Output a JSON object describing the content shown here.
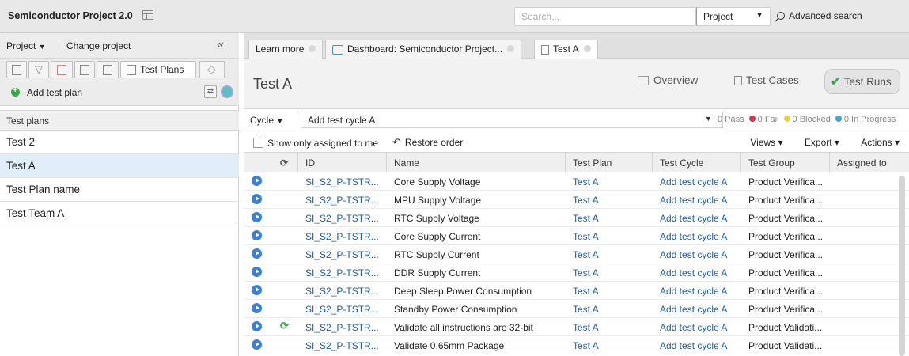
{
  "app": {
    "title": "Semiconductor Project 2.0"
  },
  "topbar": {
    "search_placeholder": "Search...",
    "scope": "Project",
    "advanced_search": "Advanced search"
  },
  "left": {
    "project_menu": "Project",
    "change_project": "Change project",
    "collapse": "«",
    "active_tab": "Test Plans",
    "add_label": "Add test plan",
    "list_header": "Test plans",
    "items": [
      "Test 2",
      "Test A",
      "Test Plan name",
      "Test Team A"
    ],
    "selected_index": 1
  },
  "tabs": [
    {
      "label": "Learn more"
    },
    {
      "label": "Dashboard: Semiconductor Project..."
    },
    {
      "label": "Test A"
    }
  ],
  "header": {
    "title": "Test A",
    "nav": [
      "Overview",
      "Test Cases",
      "Test Runs"
    ],
    "active_nav": "Test Runs"
  },
  "cycle": {
    "label": "Cycle",
    "value": "Add test cycle A",
    "stats": [
      {
        "label": "0 Pass",
        "color": "#3aa84a"
      },
      {
        "label": "0 Fail",
        "color": "#d8384a"
      },
      {
        "label": "0 Blocked",
        "color": "#e8d04a"
      },
      {
        "label": "0 In Progress",
        "color": "#4aa0d8"
      }
    ]
  },
  "filter": {
    "show_assigned": "Show only assigned to me",
    "restore": "Restore order",
    "views": "Views",
    "export": "Export",
    "actions": "Actions"
  },
  "grid": {
    "columns": [
      "ID",
      "Name",
      "Test Plan",
      "Test Cycle",
      "Test Group",
      "Assigned to"
    ],
    "rows": [
      {
        "id": "SI_S2_P-TSTR...",
        "name": "Core Supply Voltage",
        "plan": "Test A",
        "cycle": "Add test cycle A",
        "group": "Product Verifica...",
        "sync": false
      },
      {
        "id": "SI_S2_P-TSTR...",
        "name": "MPU Supply Voltage",
        "plan": "Test A",
        "cycle": "Add test cycle A",
        "group": "Product Verifica...",
        "sync": false
      },
      {
        "id": "SI_S2_P-TSTR...",
        "name": "RTC Supply Voltage",
        "plan": "Test A",
        "cycle": "Add test cycle A",
        "group": "Product Verifica...",
        "sync": false
      },
      {
        "id": "SI_S2_P-TSTR...",
        "name": "Core Supply Current",
        "plan": "Test A",
        "cycle": "Add test cycle A",
        "group": "Product Verifica...",
        "sync": false
      },
      {
        "id": "SI_S2_P-TSTR...",
        "name": "RTC Supply Current",
        "plan": "Test A",
        "cycle": "Add test cycle A",
        "group": "Product Verifica...",
        "sync": false
      },
      {
        "id": "SI_S2_P-TSTR...",
        "name": "DDR Supply Current",
        "plan": "Test A",
        "cycle": "Add test cycle A",
        "group": "Product Verifica...",
        "sync": false
      },
      {
        "id": "SI_S2_P-TSTR...",
        "name": "Deep Sleep Power Consumption",
        "plan": "Test A",
        "cycle": "Add test cycle A",
        "group": "Product Verifica...",
        "sync": false
      },
      {
        "id": "SI_S2_P-TSTR...",
        "name": "Standby Power Consumption",
        "plan": "Test A",
        "cycle": "Add test cycle A",
        "group": "Product Verifica...",
        "sync": false
      },
      {
        "id": "SI_S2_P-TSTR...",
        "name": "Validate all instructions are 32-bit",
        "plan": "Test A",
        "cycle": "Add test cycle A",
        "group": "Product Validati...",
        "sync": true
      },
      {
        "id": "SI_S2_P-TSTR...",
        "name": "Validate 0.65mm Package",
        "plan": "Test A",
        "cycle": "Add test cycle A",
        "group": "Product Validati...",
        "sync": false
      }
    ]
  }
}
